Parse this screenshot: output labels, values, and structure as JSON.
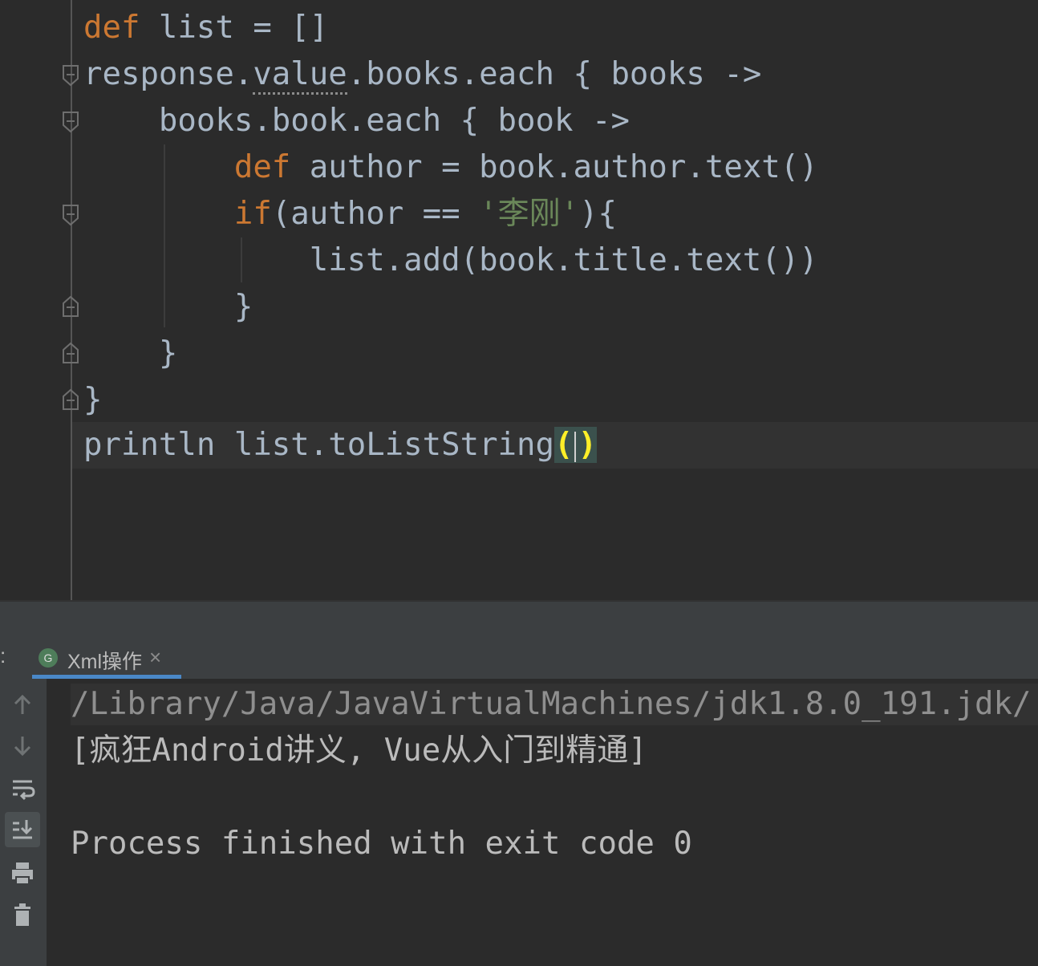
{
  "editor": {
    "lines": {
      "l1": {
        "kw": "def",
        "rest": " list = []"
      },
      "l2": {
        "pre": "response.",
        "warn": "value",
        "post": ".books.each { books ->"
      },
      "l3": {
        "text": "    books.book.each { book ->"
      },
      "l4": {
        "indent": "        ",
        "kw": "def",
        "rest": " author = book.author.text()"
      },
      "l5": {
        "indent": "        ",
        "kw": "if",
        "mid": "(author == ",
        "str": "'李刚'",
        "post": "){"
      },
      "l6": {
        "text": "            list.add(book.title.text())"
      },
      "l7": {
        "text": "        }"
      },
      "l8": {
        "text": "    }"
      },
      "l9": {
        "text": "}"
      },
      "l10": {
        "pre": "println list.toListString",
        "open": "(",
        "close": ")"
      }
    }
  },
  "tool_window": {
    "cut_label": ":",
    "tab_icon": "G",
    "tab_label": "Xml操作",
    "tab_close": "×"
  },
  "console": {
    "icons": [
      "up-arrow-icon",
      "down-arrow-icon",
      "soft-wrap-icon",
      "scroll-to-end-icon",
      "print-icon",
      "trash-icon"
    ],
    "command": "/Library/Java/JavaVirtualMachines/jdk1.8.0_191.jdk/",
    "output": "[疯狂Android讲义, Vue从入门到精通]",
    "finished": "Process finished with exit code 0"
  }
}
